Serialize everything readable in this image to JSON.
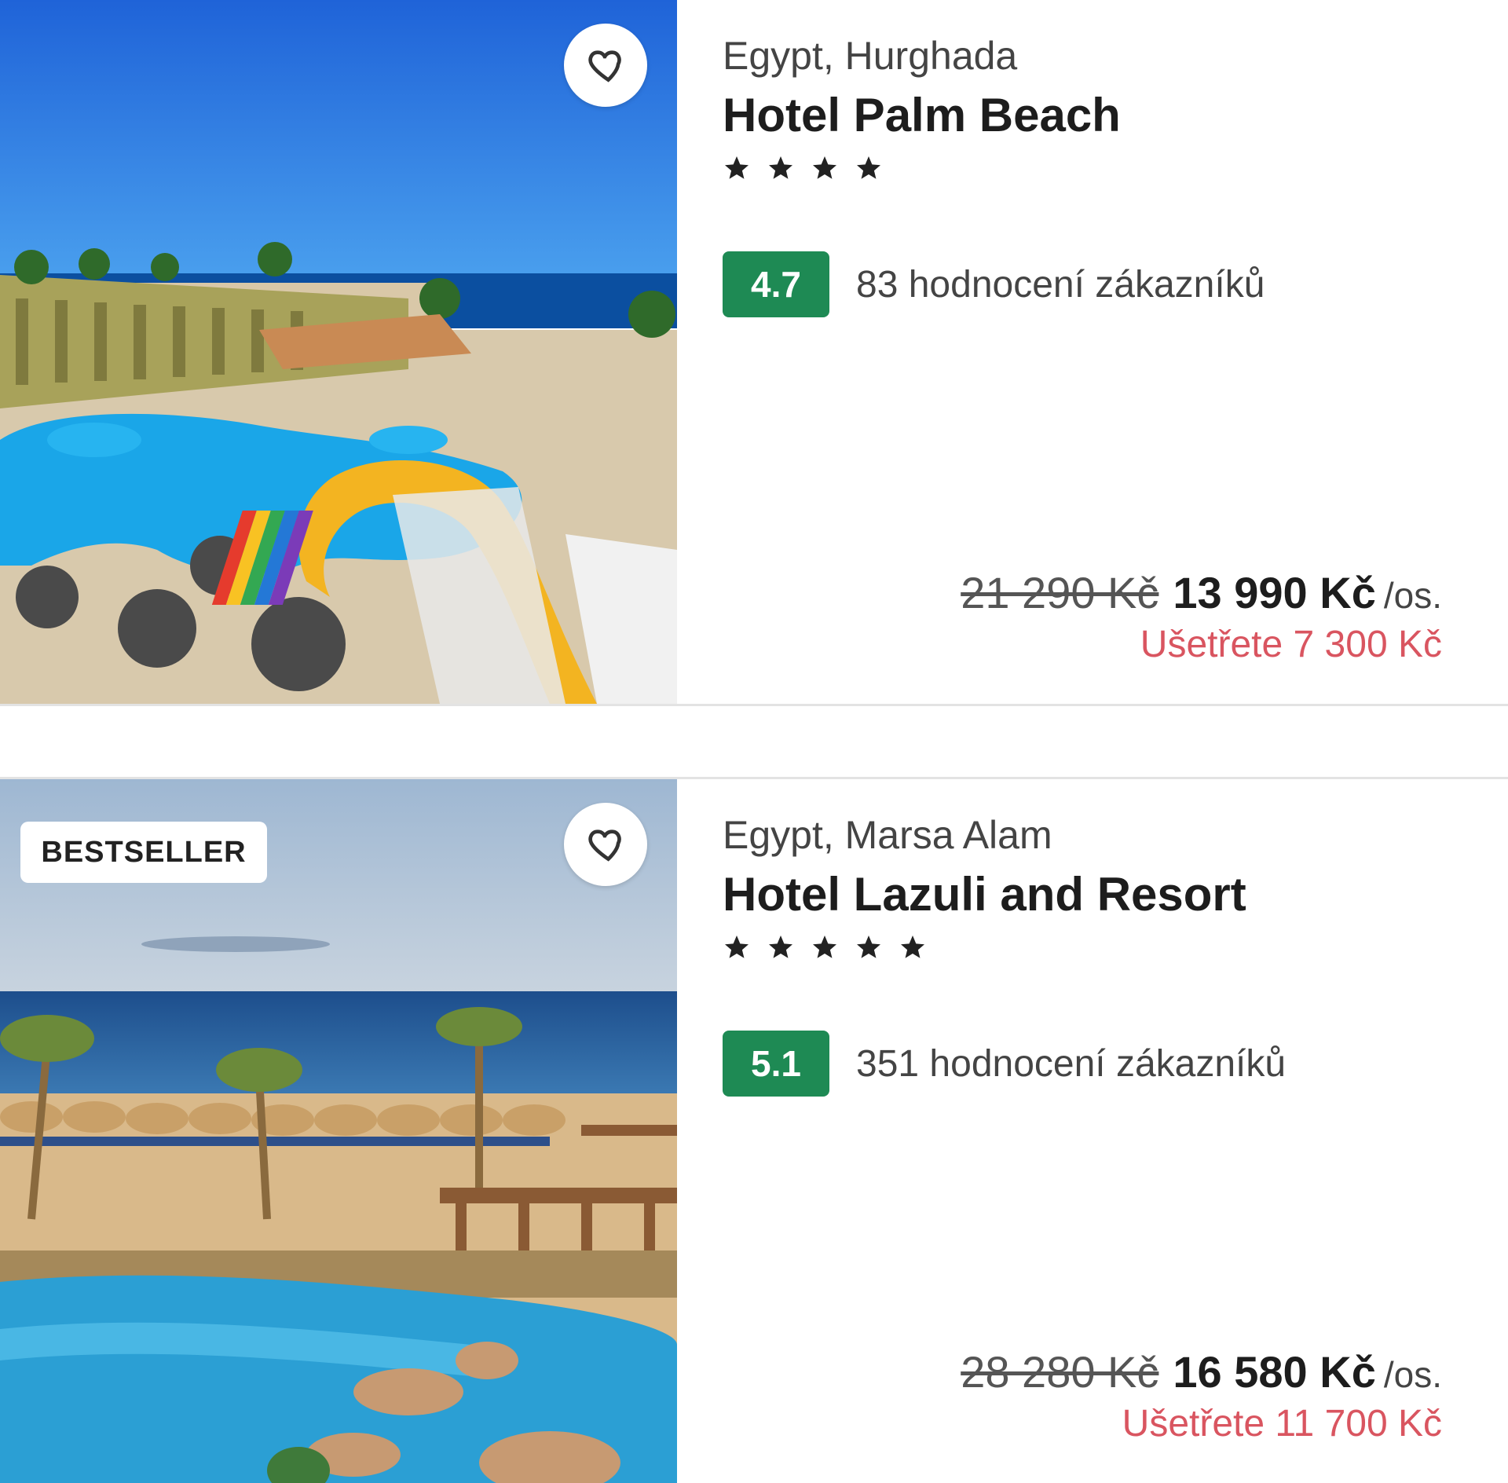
{
  "hotels": [
    {
      "location": "Egypt, Hurghada",
      "name": "Hotel Palm Beach",
      "stars": 4,
      "rating": "4.7",
      "reviews": "83 hodnocení zákazníků",
      "price_old": "21 290 Kč",
      "price_new": "13 990 Kč",
      "price_unit": "/os.",
      "savings": "Ušetřete 7 300 Kč",
      "badge": ""
    },
    {
      "location": "Egypt, Marsa Alam",
      "name": "Hotel Lazuli and Resort",
      "stars": 5,
      "rating": "5.1",
      "reviews": "351 hodnocení zákazníků",
      "price_old": "28 280 Kč",
      "price_new": "16 580 Kč",
      "price_unit": "/os.",
      "savings": "Ušetřete 11 700 Kč",
      "badge": "BESTSELLER"
    }
  ],
  "icons": {
    "favorite": "heart-icon",
    "star": "star-icon"
  },
  "colors": {
    "rating_bg": "#1e8a54",
    "savings": "#d95560"
  }
}
